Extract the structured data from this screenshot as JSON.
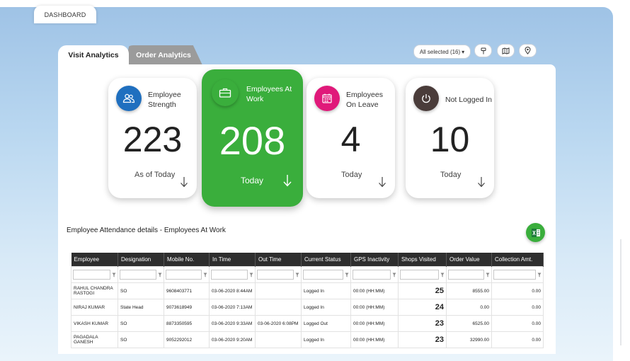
{
  "top_tab": {
    "label": "DASHBOARD"
  },
  "analytics_tabs": [
    {
      "label": "Visit Analytics",
      "active": true
    },
    {
      "label": "Order Analytics",
      "active": false
    }
  ],
  "filter": {
    "selected_label": "All selected (16)",
    "caret": "▾"
  },
  "toolbar_icons": [
    "tag-icon",
    "map-icon",
    "location-pin-icon"
  ],
  "cards": [
    {
      "title_line1": "Employee",
      "title_line2": "Strength",
      "value": "223",
      "subtitle": "As of Today",
      "icon": "users-icon",
      "badge_color": "#1f6fbf"
    },
    {
      "title_line1": "Employees At",
      "title_line2": "Work",
      "value": "208",
      "subtitle": "Today",
      "icon": "briefcase-icon",
      "badge_color": "#3aae3c"
    },
    {
      "title_line1": "Employees",
      "title_line2": "On Leave",
      "value": "4",
      "subtitle": "Today",
      "icon": "calendar-icon",
      "badge_color": "#e0197a"
    },
    {
      "title_line1": "Not Logged In",
      "title_line2": "",
      "value": "10",
      "subtitle": "Today",
      "icon": "power-icon",
      "badge_color": "#4a3c3a"
    }
  ],
  "section_title": "Employee Attendance details - Employees At Work",
  "table": {
    "columns": [
      "Employee",
      "Designation",
      "Mobile No.",
      "In Time",
      "Out Time",
      "Current Status",
      "GPS Inactivity",
      "Shops Visited",
      "Order Value",
      "Collection Amt."
    ],
    "rows": [
      [
        "RAHUL CHANDRA RASTOGI",
        "SO",
        "9608403771",
        "03-06-2020 8:44AM",
        "",
        "Logged In",
        "00:00 (HH:MM)",
        "25",
        "8555.00",
        "0.00"
      ],
      [
        "NIRAJ KUMAR",
        "State Head",
        "9073618949",
        "03-06-2020 7:13AM",
        "",
        "Logged In",
        "00:00 (HH:MM)",
        "24",
        "0.00",
        "0.00"
      ],
      [
        "VIKASH KUMAR",
        "SO",
        "8873350595",
        "03-06-2020 9:33AM",
        "03-06-2020 6:08PM",
        "Logged Out",
        "00:00 (HH:MM)",
        "23",
        "6525.00",
        "0.00"
      ],
      [
        "PAGADALA GANESH",
        "SO",
        "9052292012",
        "03-06-2020 9:20AM",
        "",
        "Logged In",
        "00:00 (HH:MM)",
        "23",
        "32990.00",
        "0.00"
      ]
    ]
  },
  "colors": {
    "accent_green": "#3aae3c",
    "link_blue": "#1f4ea8",
    "header_dark": "#2e2e2e"
  }
}
